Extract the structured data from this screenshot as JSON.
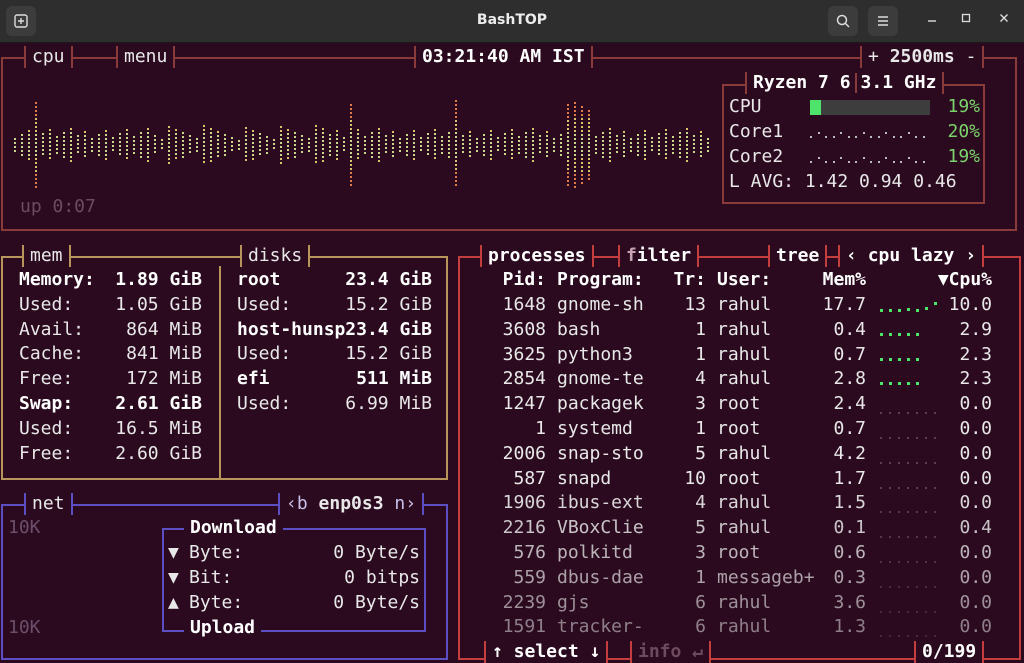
{
  "window": {
    "title": "BashTOP",
    "colors": {
      "cpu_border": "#8b3a3a",
      "mem_border": "#b8955a",
      "net_border": "#5b4fc2",
      "proc_border": "#c33e3e",
      "bg": "#2b0a1f"
    }
  },
  "cpu": {
    "tab_label": "cpu",
    "menu_label": "menu",
    "clock": "03:21:40 AM IST",
    "rate_plus": "+",
    "rate": "2500ms",
    "rate_minus": "-",
    "uptime": "up 0:07",
    "model": "Ryzen 7 6",
    "freq": "3.1 GHz",
    "rows": [
      {
        "label": "CPU",
        "pct": "19%",
        "value": 0.19
      },
      {
        "label": "Core1",
        "pct": "20%",
        "value": 0.2
      },
      {
        "label": "Core2",
        "pct": "19%",
        "value": 0.19
      }
    ],
    "load_avg": "L AVG: 1.42 0.94 0.46"
  },
  "mem": {
    "label": "mem",
    "rows": [
      {
        "k": "Memory:",
        "v": "1.89 GiB",
        "bold": true
      },
      {
        "k": "Used:",
        "v": "1.05 GiB"
      },
      {
        "k": "Avail:",
        "v": "864 MiB"
      },
      {
        "k": "Cache:",
        "v": "841 MiB"
      },
      {
        "k": "Free:",
        "v": "172 MiB"
      },
      {
        "k": "Swap:",
        "v": "2.61 GiB",
        "bold": true
      },
      {
        "k": "Used:",
        "v": "16.5 MiB"
      },
      {
        "k": "Free:",
        "v": "2.60 GiB"
      }
    ]
  },
  "disks": {
    "label": "disks",
    "rows": [
      {
        "k": "root",
        "v": "23.4 GiB",
        "bold": true
      },
      {
        "k": "Used:",
        "v": "15.2 GiB"
      },
      {
        "k": "host-hunsp",
        "v": "23.4 GiB",
        "bold": true
      },
      {
        "k": "Used:",
        "v": "15.2 GiB"
      },
      {
        "k": "efi",
        "v": "511 MiB",
        "bold": true
      },
      {
        "k": "Used:",
        "v": "6.99 MiB"
      }
    ]
  },
  "net": {
    "label": "net",
    "iface_prev": "‹b",
    "iface": "enp0s3",
    "iface_next": "n›",
    "scale_top": "10K",
    "scale_bottom": "10K",
    "download_label": "Download",
    "upload_label": "Upload",
    "rows": [
      {
        "arrow": "▼",
        "k": "Byte:",
        "v": "0 Byte/s"
      },
      {
        "arrow": "▼",
        "k": "Bit:",
        "v": "0 bitps"
      },
      {
        "arrow": "▲",
        "k": "Byte:",
        "v": "0 Byte/s"
      }
    ]
  },
  "proc": {
    "tab_processes": "processes",
    "tab_filter_f": "f",
    "tab_filter_rest": "ilter",
    "tab_tree": "tree",
    "sort_prev": "‹",
    "sort_label": "cpu lazy",
    "sort_next": "›",
    "headers": {
      "pid": "Pid:",
      "program": "Program:",
      "tr": "Tr:",
      "user": "User:",
      "mem": "Mem%",
      "cpu": "▼Cpu%"
    },
    "rows": [
      {
        "pid": "1648",
        "program": "gnome-sh",
        "tr": "13",
        "user": "rahul",
        "mem": "17.7",
        "cpu": "10.0",
        "spark": [
          0.4,
          0.4,
          0.4,
          0.5,
          0.4,
          0.6,
          0.9
        ]
      },
      {
        "pid": "3608",
        "program": "bash",
        "tr": "1",
        "user": "rahul",
        "mem": "0.4",
        "cpu": "2.9",
        "spark": [
          0.5,
          0.5,
          0.5,
          0.5,
          0.5
        ]
      },
      {
        "pid": "3625",
        "program": "python3",
        "tr": "1",
        "user": "rahul",
        "mem": "0.7",
        "cpu": "2.3",
        "spark": [
          0.5,
          0.5,
          0.5,
          0.5,
          0.5
        ]
      },
      {
        "pid": "2854",
        "program": "gnome-te",
        "tr": "4",
        "user": "rahul",
        "mem": "2.8",
        "cpu": "2.3",
        "spark": [
          0.5,
          0.5,
          0.5,
          0.5,
          0.5
        ]
      },
      {
        "pid": "1247",
        "program": "packagek",
        "tr": "3",
        "user": "root",
        "mem": "2.4",
        "cpu": "0.0",
        "spark": []
      },
      {
        "pid": "1",
        "program": "systemd",
        "tr": "1",
        "user": "root",
        "mem": "0.7",
        "cpu": "0.0",
        "spark": []
      },
      {
        "pid": "2006",
        "program": "snap-sto",
        "tr": "5",
        "user": "rahul",
        "mem": "4.2",
        "cpu": "0.0",
        "spark": []
      },
      {
        "pid": "587",
        "program": "snapd",
        "tr": "10",
        "user": "root",
        "mem": "1.7",
        "cpu": "0.0",
        "spark": []
      },
      {
        "pid": "1906",
        "program": "ibus-ext",
        "tr": "4",
        "user": "rahul",
        "mem": "1.5",
        "cpu": "0.0",
        "spark": []
      },
      {
        "pid": "2216",
        "program": "VBoxClie",
        "tr": "5",
        "user": "rahul",
        "mem": "0.1",
        "cpu": "0.4",
        "spark": []
      },
      {
        "pid": "576",
        "program": "polkitd",
        "tr": "3",
        "user": "root",
        "mem": "0.6",
        "cpu": "0.0",
        "spark": []
      },
      {
        "pid": "559",
        "program": "dbus-dae",
        "tr": "1",
        "user": "messageb+",
        "mem": "0.3",
        "cpu": "0.0",
        "spark": []
      },
      {
        "pid": "2239",
        "program": "gjs",
        "tr": "6",
        "user": "rahul",
        "mem": "3.6",
        "cpu": "0.0",
        "spark": []
      },
      {
        "pid": "1591",
        "program": "tracker-",
        "tr": "6",
        "user": "rahul",
        "mem": "1.3",
        "cpu": "0.0",
        "spark": []
      }
    ],
    "footer_select": "↑ select ↓",
    "footer_info": "info ↵",
    "footer_count": "0/199"
  }
}
